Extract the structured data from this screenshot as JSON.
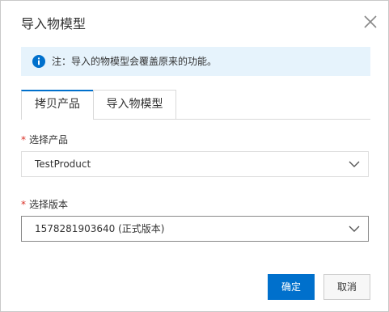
{
  "dialog": {
    "title": "导入物模型",
    "close_icon": "close-icon"
  },
  "notice": {
    "icon": "info-icon",
    "text": "注：导入的物模型会覆盖原来的功能。",
    "background": "#e6f3fc",
    "icon_color": "#0070cc"
  },
  "tabs": [
    {
      "label": "拷贝产品",
      "active": true
    },
    {
      "label": "导入物模型",
      "active": false
    }
  ],
  "form": {
    "product": {
      "required_mark": "*",
      "label": "选择产品",
      "value": "TestProduct"
    },
    "version": {
      "required_mark": "*",
      "label": "选择版本",
      "value": "1578281903640 (正式版本)"
    }
  },
  "footer": {
    "confirm_label": "确定",
    "cancel_label": "取消"
  },
  "colors": {
    "accent": "#0070cc",
    "required": "#d93026"
  }
}
